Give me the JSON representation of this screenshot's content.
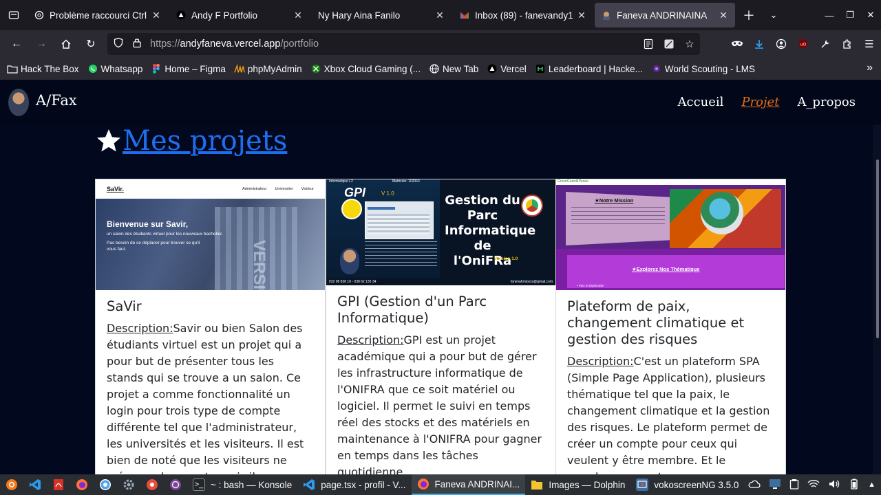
{
  "browser": {
    "tabs": [
      {
        "title": "Problème raccourci Ctrl",
        "icon": "chatgpt-icon"
      },
      {
        "title": "Andy F Portfolio",
        "icon": "vercel-icon"
      },
      {
        "title": "Ny Hary Aina Fanilo",
        "icon": "none"
      },
      {
        "title": "Inbox (89) - fanevandy1",
        "icon": "gmail-icon"
      },
      {
        "title": "Faneva ANDRINAINA",
        "icon": "site-favicon-icon",
        "active": true
      }
    ],
    "url_prefix": "https://",
    "url_host": "andyfaneva.vercel.app",
    "url_path": "/portfolio",
    "bookmarks": [
      {
        "label": "Hack The Box",
        "icon": "folder-icon"
      },
      {
        "label": "Whatsapp",
        "icon": "whatsapp-icon"
      },
      {
        "label": "Home – Figma",
        "icon": "figma-icon"
      },
      {
        "label": "phpMyAdmin",
        "icon": "phpmyadmin-icon"
      },
      {
        "label": "Xbox Cloud Gaming (...",
        "icon": "xbox-icon"
      },
      {
        "label": "New Tab",
        "icon": "globe-icon"
      },
      {
        "label": "Vercel",
        "icon": "vercel-icon"
      },
      {
        "label": "Leaderboard | Hacke...",
        "icon": "hackerrank-icon"
      },
      {
        "label": "World Scouting - LMS",
        "icon": "scouting-icon"
      }
    ]
  },
  "site": {
    "brand": "A/Fax",
    "nav": [
      {
        "label": "Accueil",
        "active": false
      },
      {
        "label": "Projet",
        "active": true
      },
      {
        "label": "A_propos",
        "active": false
      }
    ],
    "heading": "Mes projets",
    "projects": [
      {
        "title": "SaVir",
        "desc_label": "Description:",
        "desc": "Savir ou bien Salon des étudiants virtuel est un projet qui a pour but de présenter tous les stands qui se trouve a un salon. Ce projet a comme fonctionnalité un login pour trois type de compte différente tel que l'administrateur, les universités et les visiteurs. Il est bien de noté que les visiteurs ne crée pas de compte mais ils",
        "thumb": {
          "logo": "SaVir.",
          "menu": [
            "Administrateur",
            "Universiter",
            "Visiteur"
          ],
          "headline": "Bienvenue sur Savir,",
          "line1": "un salon des étudiants virtuel pour les nouveaux bachelier.",
          "line2": "Pas besoin de se déplacer pour trouver se qu'il vous faut."
        }
      },
      {
        "title": "GPI (Gestion d'un Parc Informatique)",
        "desc_label": "Description:",
        "desc": "GPI est un projet académique qui a pour but de gérer les infrastructure informatique de l'ONIFRA que ce soit matériel ou logiciel. Il permet le suivi en temps réel des stocks et des matériels en maintenance à l'ONIFRA pour gagner en temps dans les tâches quotidienne.",
        "thumb": {
          "top_left": "Informatique L2",
          "top_right": "Matricule: 102063",
          "gpi": "GPI",
          "version_small": "V 1.0",
          "big1": "Gestion du",
          "big2": "Parc",
          "big3": "Informatique",
          "big4": "de l'OniFRa",
          "version": "Version 1.0",
          "footer_left": "032 98 838 10 - 038 62 135 34",
          "footer_right": "fanevahmioxxx@gmail.com"
        }
      },
      {
        "title": "Plateform de paix, changement climatique et gestion des risques",
        "desc_label": "Description:",
        "desc": "C'est un plateform SPA (Simple Page Application), plusieurs thématique tel que la paix, le changement climatique et la gestion des risques. Le plateform permet de créer un compte pour ceux qui veulent y être membre. Et le membre peuvent",
        "thumb": {
          "logo": "GreenGuard4Peace",
          "mission": "★Notre Mission",
          "explore": "★Explorez Nos Thématique",
          "item": "• Paix et Diplomatie"
        }
      }
    ]
  },
  "taskbar": {
    "windows": [
      {
        "label": "~ : bash — Konsole",
        "icon": "terminal-icon",
        "active": false
      },
      {
        "label": "page.tsx - profil - V...",
        "icon": "vscode-icon",
        "active": false
      },
      {
        "label": "Faneva ANDRINAI...",
        "icon": "firefox-icon",
        "active": true
      },
      {
        "label": "Images — Dolphin",
        "icon": "folder-icon",
        "active": false
      },
      {
        "label": "vokoscreenNG 3.5.0",
        "icon": "vokoscreen-icon",
        "active": false
      }
    ]
  }
}
